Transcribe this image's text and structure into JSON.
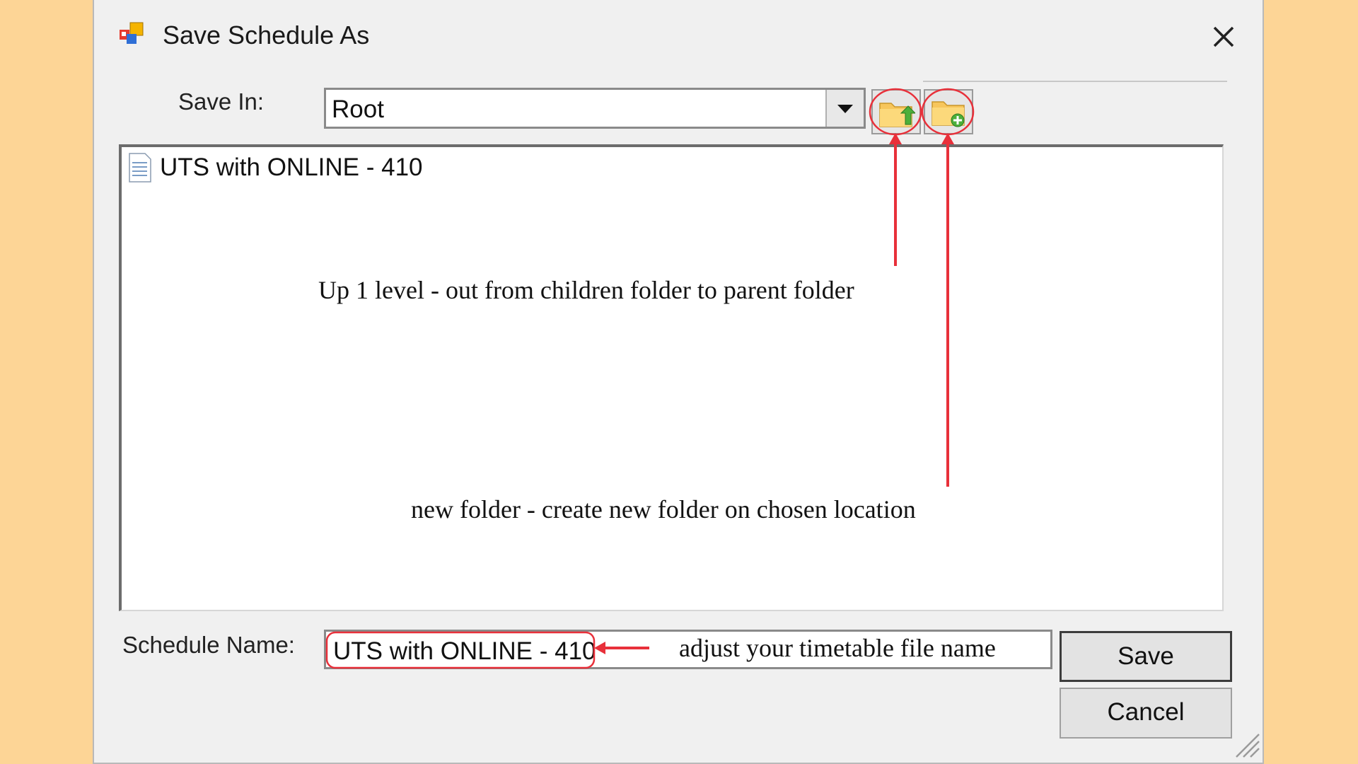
{
  "window": {
    "title": "Save Schedule As",
    "app_icon": "app-icon",
    "close_icon": "close-icon"
  },
  "save_in": {
    "label": "Save In:",
    "value": "Root",
    "dropdown_icon": "chevron-down-icon"
  },
  "toolbar": {
    "up_level_icon": "folder-up-icon",
    "new_folder_icon": "new-folder-icon"
  },
  "file_list": {
    "items": [
      {
        "name": "UTS with ONLINE - 410",
        "icon": "document-icon"
      }
    ]
  },
  "schedule_name": {
    "label": "Schedule Name:",
    "value": "UTS with ONLINE - 410"
  },
  "buttons": {
    "save": "Save",
    "cancel": "Cancel"
  },
  "annotations": {
    "up_level": "Up 1 level - out from children folder to parent folder",
    "new_folder": "new folder - create new folder on chosen location",
    "file_name": "adjust your timetable file name",
    "color": "#e8303a"
  },
  "colors": {
    "background": "#fdd596",
    "dialog": "#f0f0f0"
  }
}
